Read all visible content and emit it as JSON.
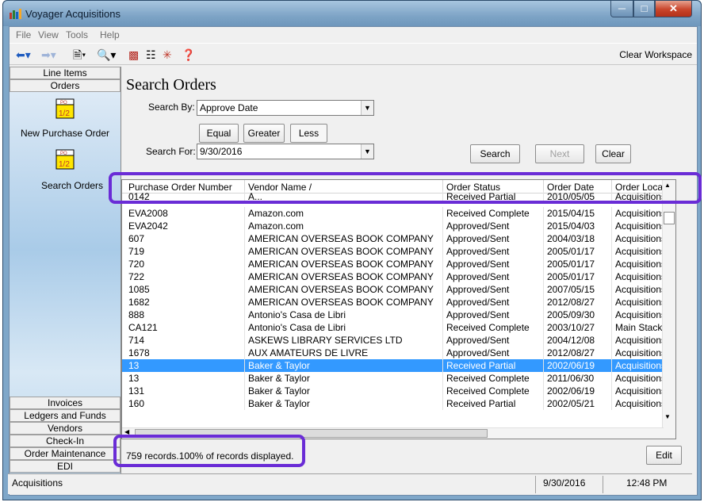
{
  "window": {
    "title": "Voyager Acquisitions"
  },
  "menu": [
    "File",
    "View",
    "Tools",
    "Help"
  ],
  "toolbar": {
    "clear_workspace": "Clear Workspace"
  },
  "nav": {
    "top_buttons": [
      "Line Items",
      "Orders"
    ],
    "items": [
      {
        "label": "New Purchase Order",
        "icon": "po-icon"
      },
      {
        "label": "Search Orders",
        "icon": "po-icon"
      }
    ],
    "bottom_buttons": [
      "Invoices",
      "Ledgers and Funds",
      "Vendors",
      "Check-In",
      "Order Maintenance",
      "EDI"
    ]
  },
  "search": {
    "title": "Search Orders",
    "search_by_label": "Search By:",
    "search_by_value": "Approve Date",
    "search_for_label": "Search For:",
    "search_for_value": "9/30/2016",
    "compare_buttons": [
      "Equal",
      "Greater",
      "Less"
    ],
    "action_buttons": {
      "search": "Search",
      "next": "Next",
      "clear": "Clear"
    }
  },
  "table": {
    "columns": [
      "Purchase Order Number",
      "Vendor Name /",
      "Order Status",
      "Order Date",
      "Order Location"
    ],
    "partial_row": [
      "0142",
      "A...",
      "Received Partial",
      "2010/05/05",
      "Acquisitions"
    ],
    "rows": [
      [
        "EVA2008",
        "Amazon.com",
        "Received Complete",
        "2015/04/15",
        "Acquisitions"
      ],
      [
        "EVA2042",
        "Amazon.com",
        "Approved/Sent",
        "2015/04/03",
        "Acquisitions"
      ],
      [
        "607",
        "AMERICAN OVERSEAS BOOK COMPANY",
        "Approved/Sent",
        "2004/03/18",
        "Acquisitions"
      ],
      [
        "719",
        "AMERICAN OVERSEAS BOOK COMPANY",
        "Approved/Sent",
        "2005/01/17",
        "Acquisitions"
      ],
      [
        "720",
        "AMERICAN OVERSEAS BOOK COMPANY",
        "Approved/Sent",
        "2005/01/17",
        "Acquisitions"
      ],
      [
        "722",
        "AMERICAN OVERSEAS BOOK COMPANY",
        "Approved/Sent",
        "2005/01/17",
        "Acquisitions"
      ],
      [
        "1085",
        "AMERICAN OVERSEAS BOOK COMPANY",
        "Approved/Sent",
        "2007/05/15",
        "Acquisitions"
      ],
      [
        "1682",
        "AMERICAN OVERSEAS BOOK COMPANY",
        "Approved/Sent",
        "2012/08/27",
        "Acquisitions"
      ],
      [
        "888",
        "Antonio's Casa de Libri",
        "Approved/Sent",
        "2005/09/30",
        "Acquisitions"
      ],
      [
        "CA121",
        "Antonio's Casa de Libri",
        "Received Complete",
        "2003/10/27",
        "Main Stacks"
      ],
      [
        "714",
        "ASKEWS LIBRARY SERVICES LTD",
        "Approved/Sent",
        "2004/12/08",
        "Acquisitions"
      ],
      [
        "1678",
        "AUX AMATEURS DE LIVRE",
        "Approved/Sent",
        "2012/08/27",
        "Acquisitions"
      ],
      [
        "13",
        "Baker & Taylor",
        "Received Partial",
        "2002/06/19",
        "Acquisitions"
      ],
      [
        "13",
        "Baker & Taylor",
        "Received Complete",
        "2011/06/30",
        "Acquisitions"
      ],
      [
        "131",
        "Baker & Taylor",
        "Received Complete",
        "2002/06/19",
        "Acquisitions"
      ],
      [
        "160",
        "Baker & Taylor",
        "Received Partial",
        "2002/05/21",
        "Acquisitions"
      ]
    ],
    "selected_row": 12
  },
  "footer": {
    "records": "759  records.100% of records displayed.",
    "edit": "Edit"
  },
  "statusbar": {
    "module": "Acquisitions",
    "date": "9/30/2016",
    "time": "12:48 PM"
  },
  "colors": {
    "selection": "#3399ff",
    "highlight": "#6a2cd6"
  }
}
